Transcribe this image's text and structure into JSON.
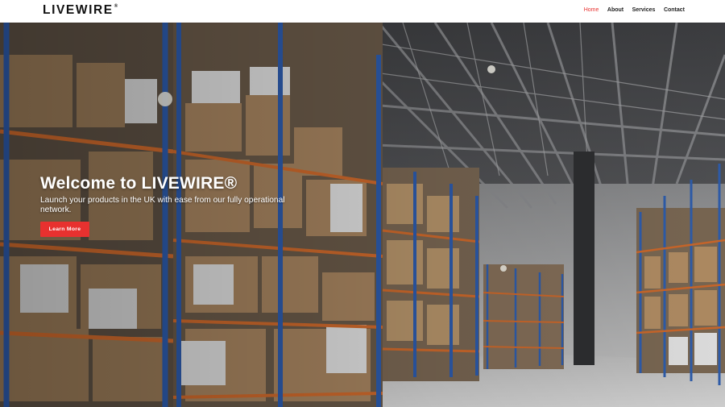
{
  "header": {
    "logo_text": "LIVEWIRE",
    "logo_registered": "®",
    "nav": [
      {
        "label": "Home",
        "active": true
      },
      {
        "label": "About",
        "active": false
      },
      {
        "label": "Services",
        "active": false
      },
      {
        "label": "Contact",
        "active": false
      }
    ]
  },
  "hero": {
    "title": "Welcome to LIVEWIRE®",
    "subtitle": "Launch your products in the UK with ease from our fully operational network.",
    "cta_label": "Learn More",
    "background": "warehouse-shelving-photo"
  },
  "colors": {
    "accent": "#e8312f",
    "text_dark": "#111111",
    "hero_text": "#ffffff"
  }
}
